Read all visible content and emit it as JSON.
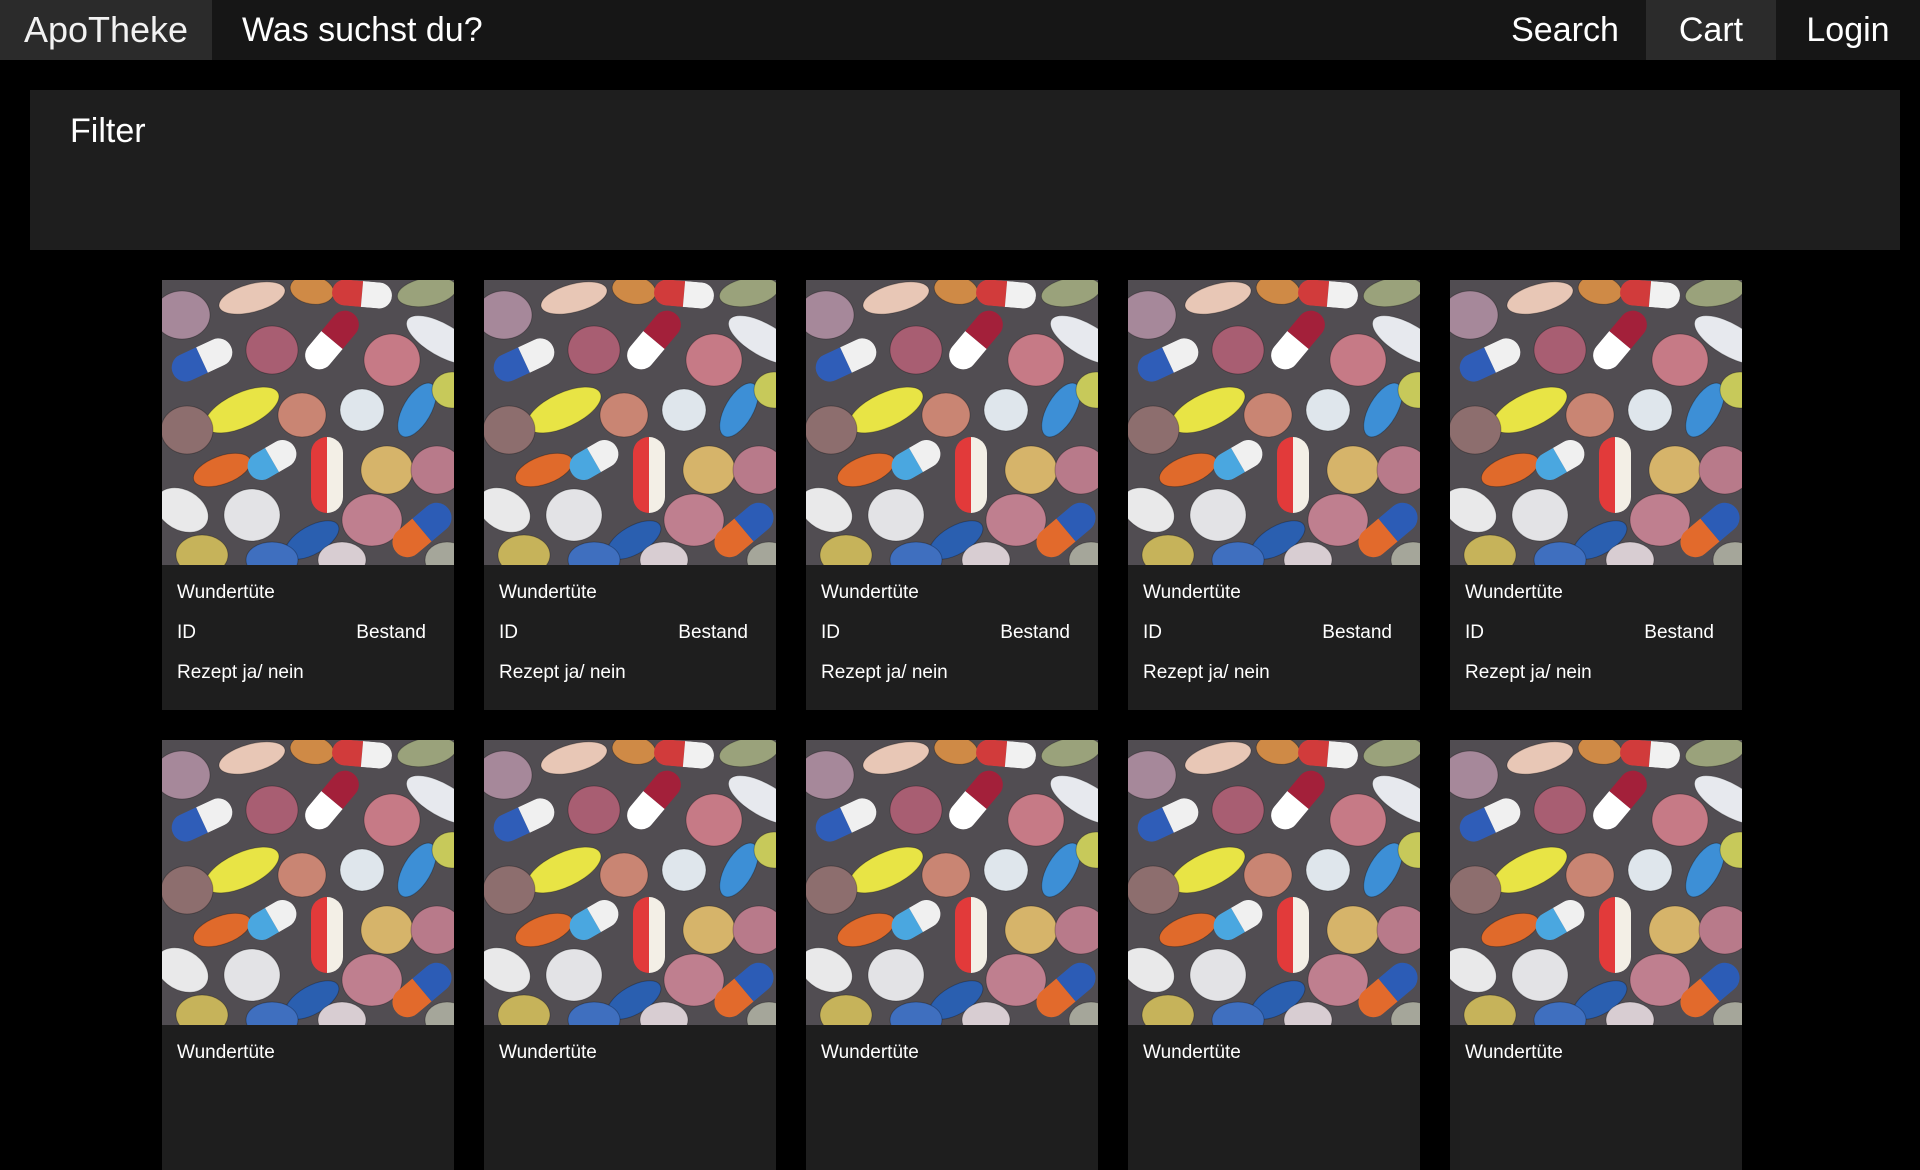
{
  "header": {
    "brand": "ApoTheke",
    "search_placeholder": "Was suchst du?",
    "nav": {
      "search": "Search",
      "cart": "Cart",
      "login": "Login"
    }
  },
  "filter": {
    "title": "Filter"
  },
  "products": [
    {
      "name": "Wundertüte",
      "id_label": "ID",
      "stock_label": "Bestand",
      "rx_label": "Rezept ja/ nein"
    },
    {
      "name": "Wundertüte",
      "id_label": "ID",
      "stock_label": "Bestand",
      "rx_label": "Rezept ja/ nein"
    },
    {
      "name": "Wundertüte",
      "id_label": "ID",
      "stock_label": "Bestand",
      "rx_label": "Rezept ja/ nein"
    },
    {
      "name": "Wundertüte",
      "id_label": "ID",
      "stock_label": "Bestand",
      "rx_label": "Rezept ja/ nein"
    },
    {
      "name": "Wundertüte",
      "id_label": "ID",
      "stock_label": "Bestand",
      "rx_label": "Rezept ja/ nein"
    },
    {
      "name": "Wundertüte"
    },
    {
      "name": "Wundertüte"
    },
    {
      "name": "Wundertüte"
    },
    {
      "name": "Wundertüte"
    },
    {
      "name": "Wundertüte"
    }
  ]
}
